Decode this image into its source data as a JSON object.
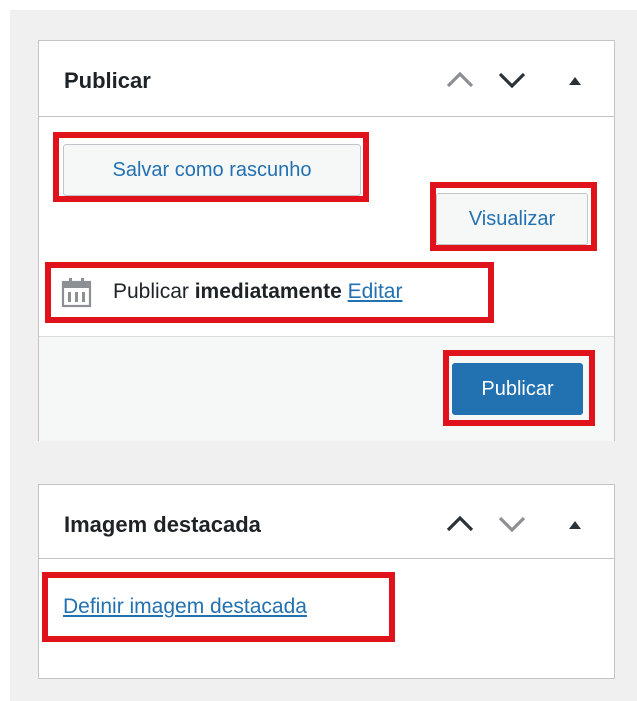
{
  "publish_panel": {
    "title": "Publicar",
    "move_up_icon": "chevron-up-icon",
    "move_down_icon": "chevron-down-icon",
    "toggle_icon": "triangle-up-icon",
    "save_draft_label": "Salvar como rascunho",
    "preview_label": "Visualizar",
    "schedule": {
      "icon": "calendar-icon",
      "prefix": "Publicar",
      "value": "imediatamente",
      "edit_label": "Editar"
    },
    "publish_button_label": "Publicar"
  },
  "featured_image_panel": {
    "title": "Imagem destacada",
    "move_up_icon": "chevron-up-icon",
    "move_down_icon": "chevron-down-icon",
    "toggle_icon": "triangle-up-icon",
    "set_image_label": "Definir imagem destacada"
  },
  "colors": {
    "accent": "#2271b1",
    "highlight": "#e0121b",
    "text": "#1d2327",
    "border": "#c3c4c7",
    "background": "#f0f0f1"
  }
}
